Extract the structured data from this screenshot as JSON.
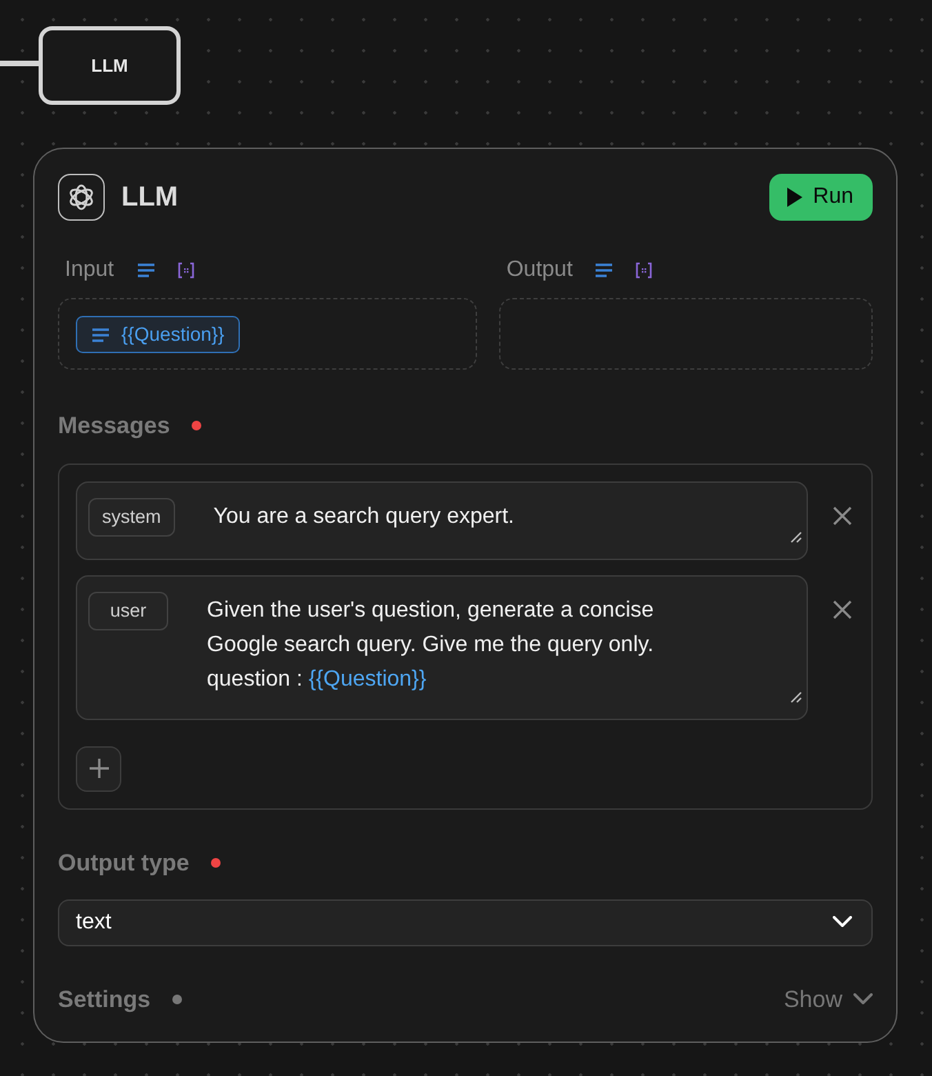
{
  "top_node": {
    "label": "LLM"
  },
  "card": {
    "title": "LLM",
    "run_button": "Run"
  },
  "ports": [
    {
      "label": "Input",
      "chips": [
        {
          "label": "{{Question}}"
        }
      ]
    },
    {
      "label": "Output"
    }
  ],
  "messages_section": {
    "label": "Messages",
    "required": true
  },
  "messages": [
    {
      "role": "system",
      "content": [
        {
          "kind": "text",
          "text": "You are a search query expert."
        }
      ]
    },
    {
      "role": "user",
      "content": [
        {
          "kind": "text",
          "text": "Given the user's question, generate a concise Google search query. Give me the query only. question : "
        },
        {
          "kind": "variable",
          "text": "{{Question}}"
        }
      ]
    }
  ],
  "output_type": {
    "label": "Output type",
    "required": true,
    "value": "text"
  },
  "settings": {
    "label": "Settings",
    "required": false,
    "toggle": "Show",
    "expanded": false
  }
}
